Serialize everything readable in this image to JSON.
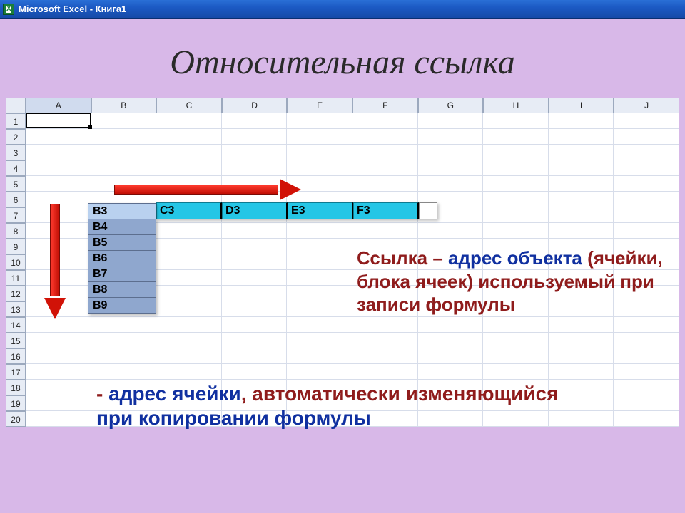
{
  "window": {
    "title": "Microsoft Excel - Книга1"
  },
  "slide": {
    "title": "Относительная ссылка",
    "columns": [
      "A",
      "B",
      "C",
      "D",
      "E",
      "F",
      "G",
      "H",
      "I",
      "J"
    ],
    "rows": [
      "1",
      "2",
      "3",
      "4",
      "5",
      "6",
      "7",
      "8",
      "9",
      "10",
      "11",
      "12",
      "13",
      "14",
      "15",
      "16",
      "17",
      "18",
      "19",
      "20"
    ],
    "bcol": [
      "B3",
      "B4",
      "B5",
      "B6",
      "B7",
      "B8",
      "B9"
    ],
    "cyan": [
      "C3",
      "D3",
      "E3",
      "F3"
    ],
    "def1": {
      "link": "Ссылка",
      "sep": " – ",
      "addr": "адрес объекта",
      "rest": " (ячейки, блока ячеек) используемый при записи формулы"
    },
    "def2": {
      "dash": "- ",
      "p1_blue": "адрес ячейки",
      "p1_maroon": ", автоматически изменяющийся",
      "p2_blue": " при копировании формулы"
    }
  }
}
